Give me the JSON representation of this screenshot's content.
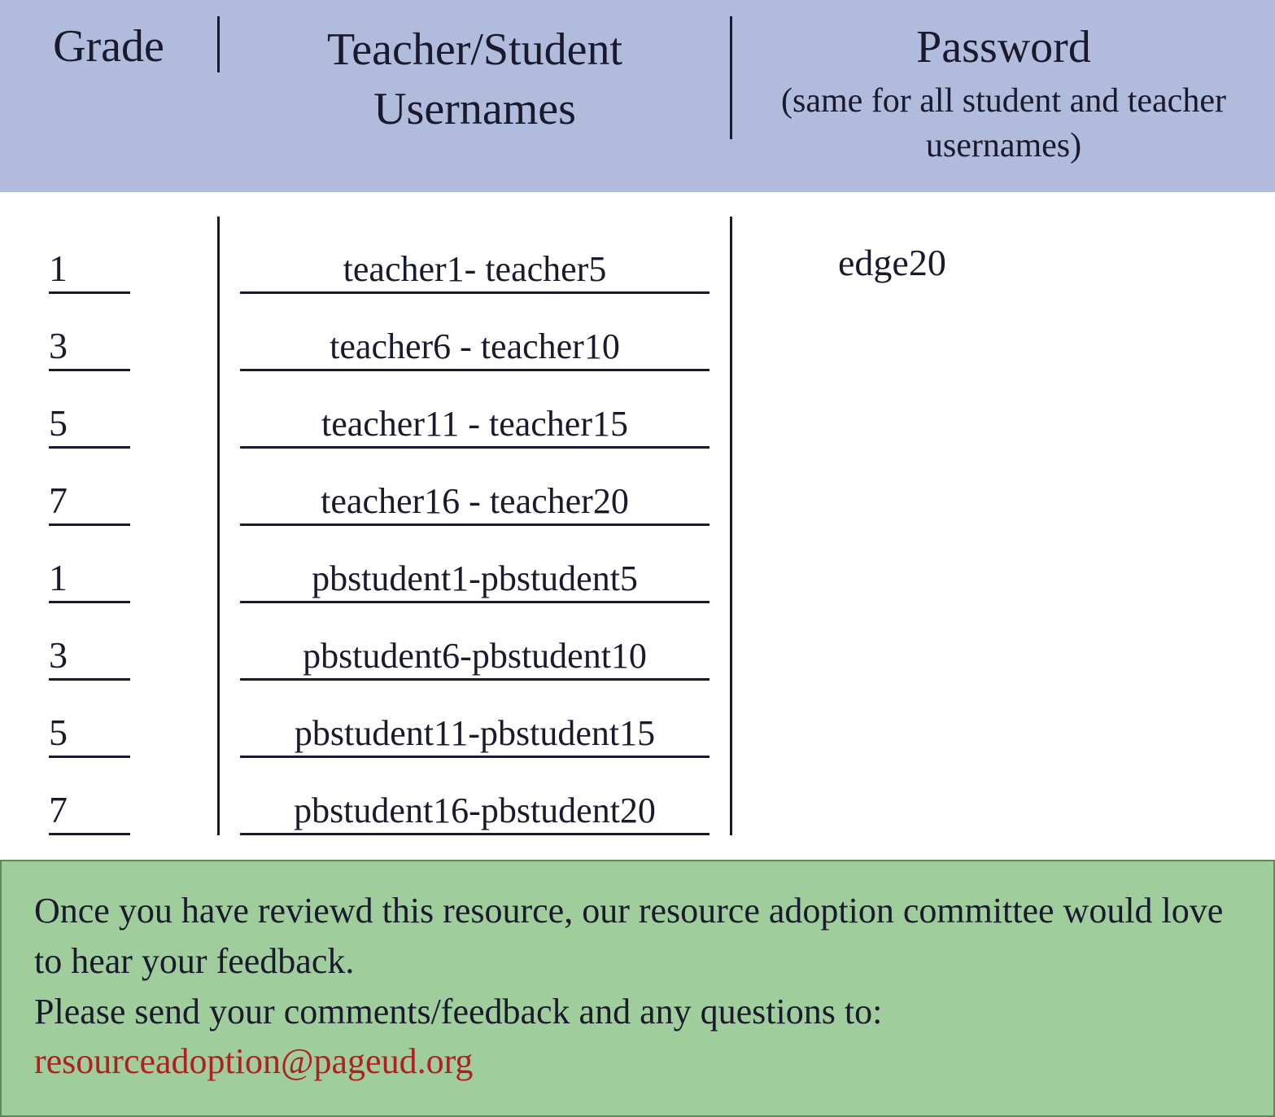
{
  "header": {
    "grade": "Grade",
    "usernames": "Teacher/Student Usernames",
    "password_title": "Password",
    "password_sub": "(same for all student and teacher usernames)"
  },
  "rows": [
    {
      "grade": "1",
      "usernames": "teacher1- teacher5"
    },
    {
      "grade": "3",
      "usernames": "teacher6 - teacher10"
    },
    {
      "grade": "5",
      "usernames": "teacher11 - teacher15"
    },
    {
      "grade": "7",
      "usernames": "teacher16 - teacher20"
    },
    {
      "grade": "1",
      "usernames": "pbstudent1-pbstudent5"
    },
    {
      "grade": "3",
      "usernames": "pbstudent6-pbstudent10"
    },
    {
      "grade": "5",
      "usernames": "pbstudent11-pbstudent15"
    },
    {
      "grade": "7",
      "usernames": "pbstudent16-pbstudent20"
    }
  ],
  "password": "edge20",
  "footer": {
    "line1": "Once you have reviewd this resource, our resource adoption committee would love to hear your feedback.",
    "line2": "Please send your comments/feedback and any questions to:",
    "email": "resourceadoption@pageud.org"
  }
}
